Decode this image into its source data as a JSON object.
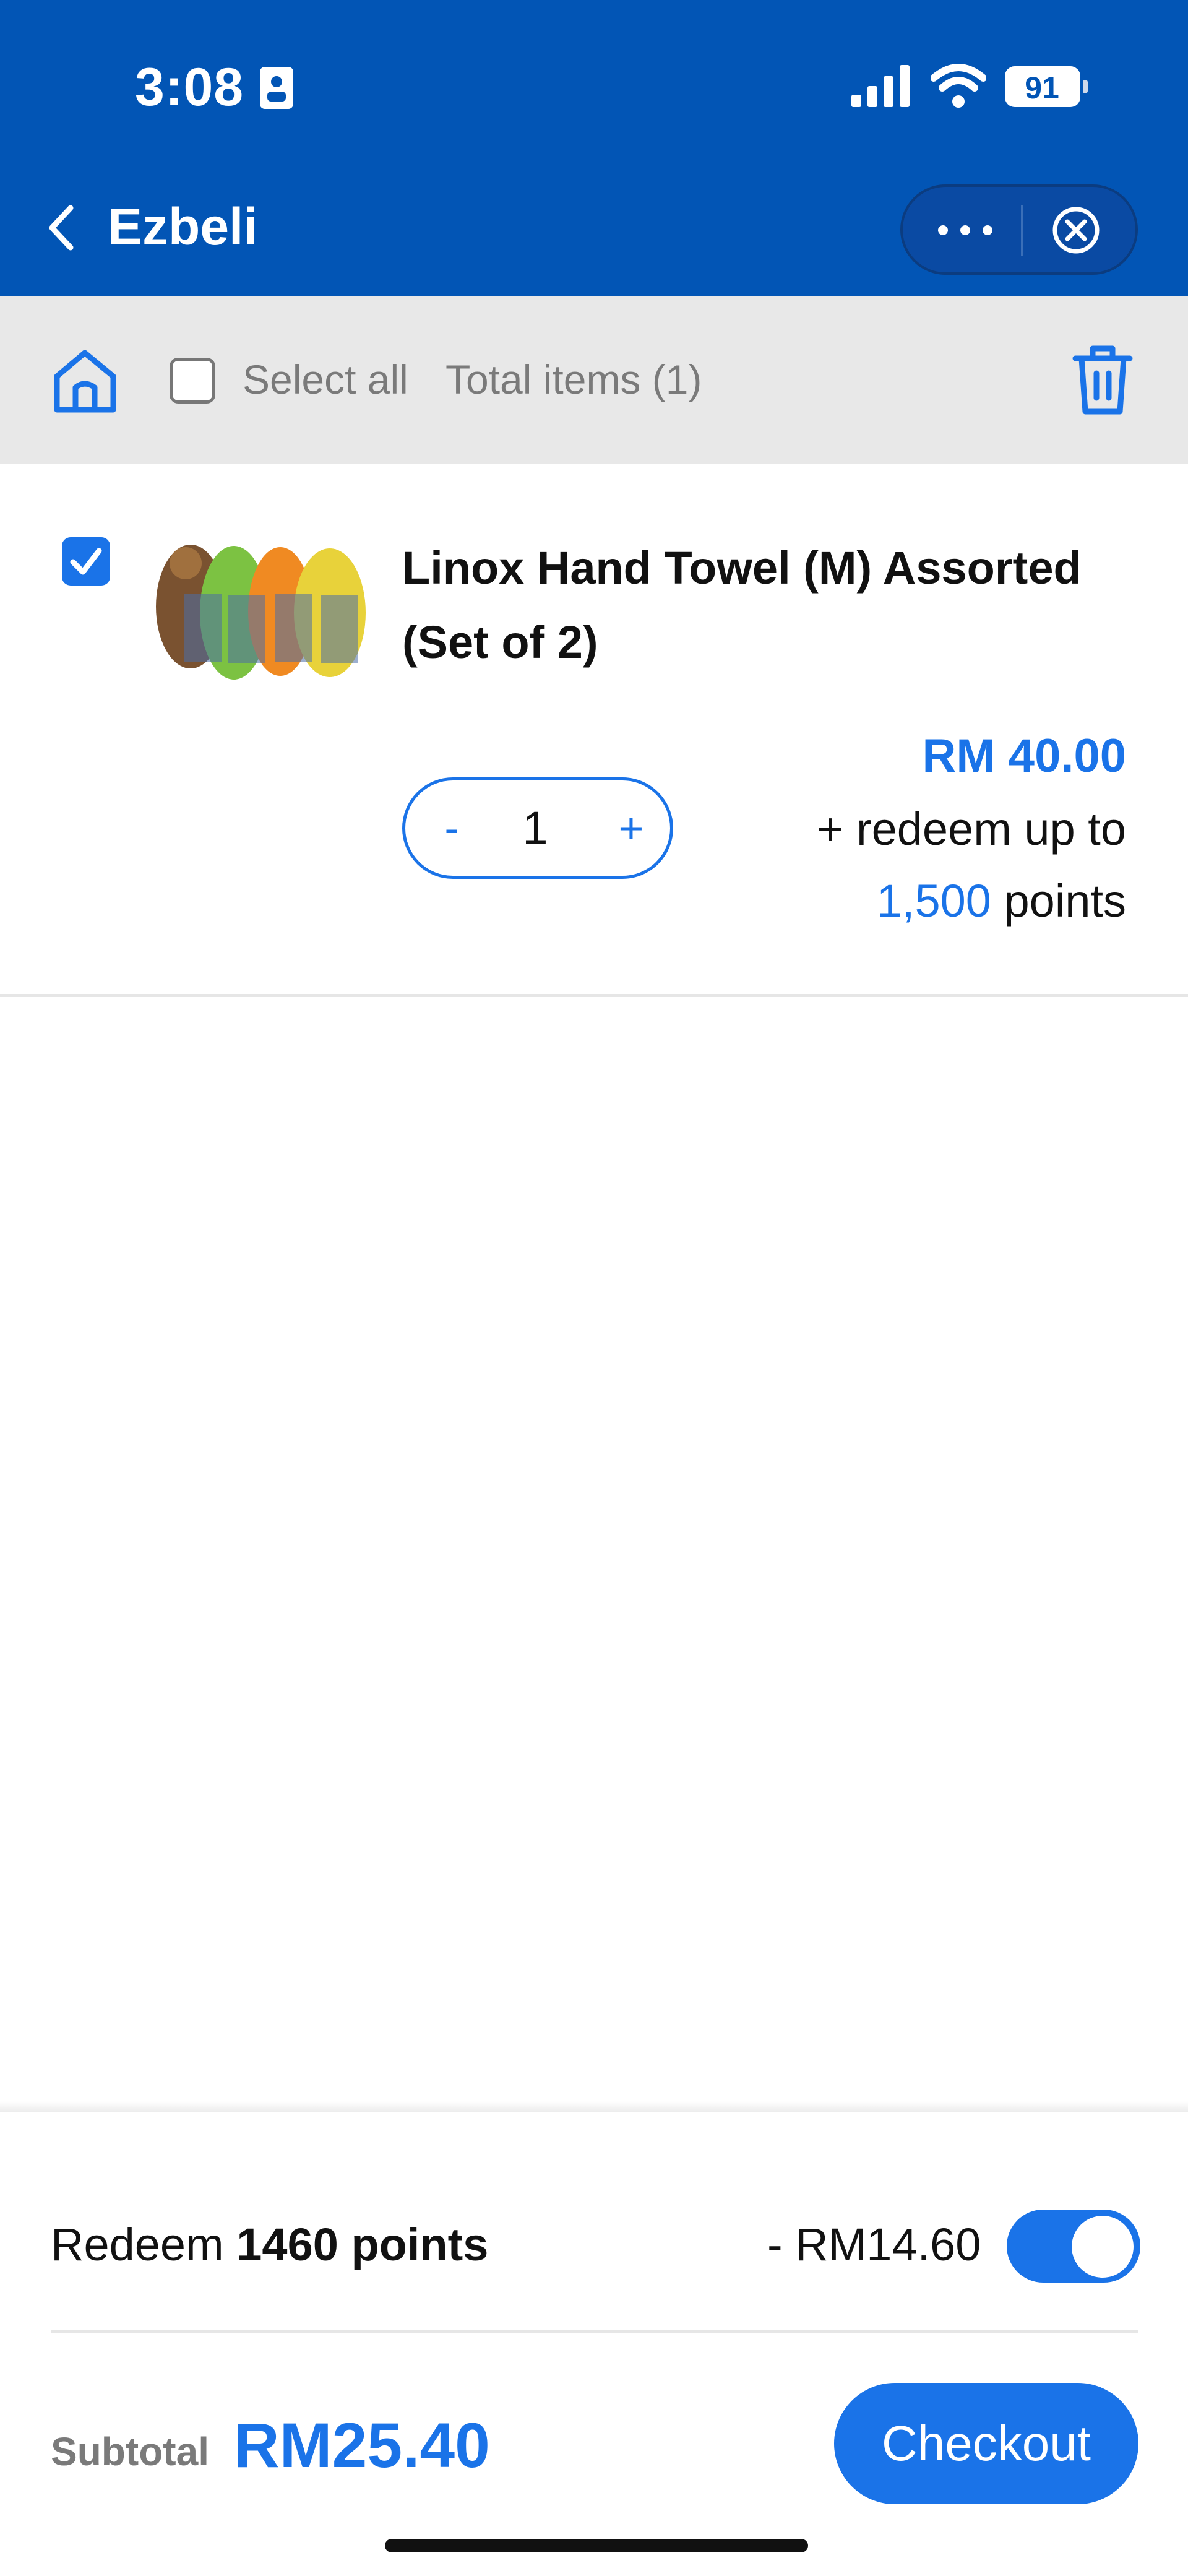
{
  "status_bar": {
    "time": "3:08",
    "battery": "91"
  },
  "header": {
    "title": "Ezbeli",
    "icons": [
      "chevron-left-icon",
      "more-icon",
      "close-circle-icon"
    ]
  },
  "toolbar": {
    "select_all": "Select all",
    "total_items": "Total items (1)",
    "icons": [
      "home-icon",
      "trash-icon"
    ]
  },
  "cart_item": {
    "selected": true,
    "name": "Linox Hand Towel (M) Assorted (Set of 2)",
    "price": "RM 40.00",
    "redeem_prefix": "+ redeem up to",
    "redeem_points": "1,500",
    "redeem_suffix": "points",
    "quantity": "1",
    "minus": "-",
    "plus": "+"
  },
  "summary": {
    "redeem_prefix": "Redeem",
    "redeem_points": "1460 points",
    "discount": "- RM14.60",
    "redeem_enabled": true,
    "subtotal_label": "Subtotal",
    "subtotal": "RM25.40",
    "checkout_label": "Checkout"
  },
  "colors": {
    "header": "#0255b5",
    "accent": "#1a73e8",
    "toolbar_bg": "#e8e8e8"
  }
}
